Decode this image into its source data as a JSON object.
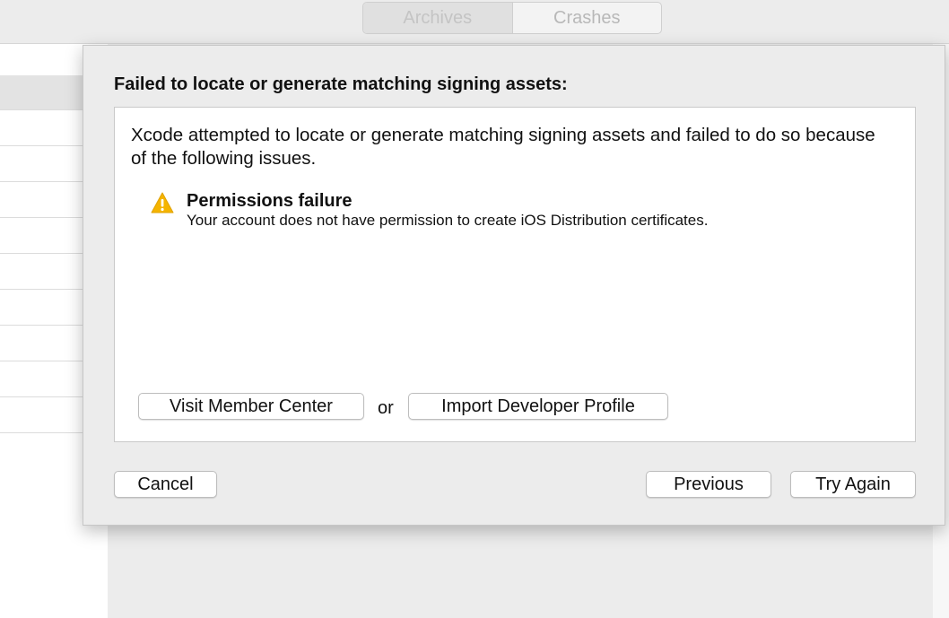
{
  "toolbar": {
    "segments": [
      "Archives",
      "Crashes"
    ],
    "selected_segment": "Archives"
  },
  "sheet": {
    "title": "Failed to locate or generate matching signing assets:",
    "intro": "Xcode attempted to locate or generate matching signing assets and failed to do so because of the following issues.",
    "issues": [
      {
        "icon": "warning-icon",
        "title": "Permissions failure",
        "detail": "Your account does not have permission to create iOS Distribution certificates."
      }
    ],
    "visit_button": "Visit Member Center",
    "or_label": "or",
    "import_button": "Import Developer Profile",
    "cancel_button": "Cancel",
    "previous_button": "Previous",
    "try_again_button": "Try Again"
  },
  "colors": {
    "warning": "#f5b400",
    "sheet_bg": "#ececec"
  }
}
